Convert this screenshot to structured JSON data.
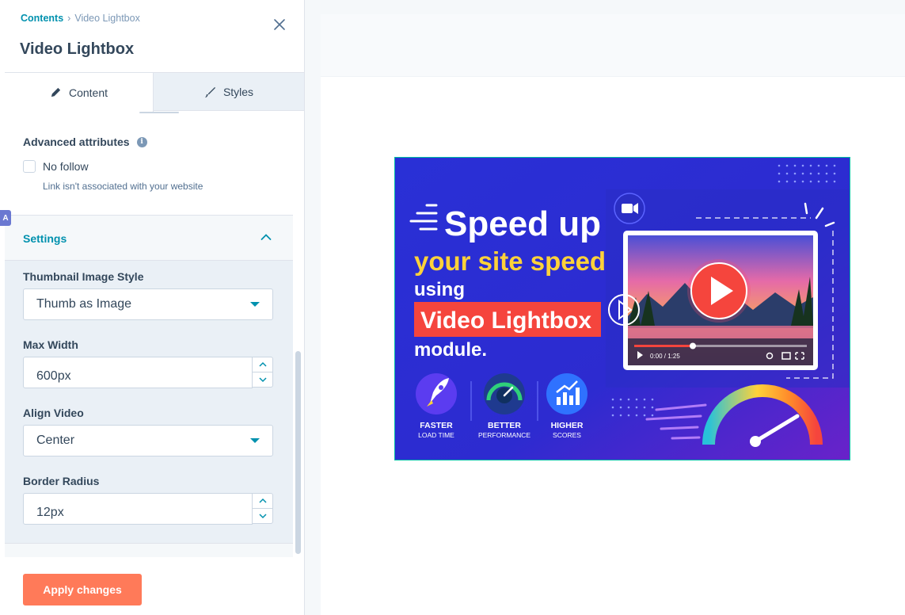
{
  "breadcrumb": {
    "parent": "Contents",
    "separator": "›",
    "current": "Video Lightbox"
  },
  "panel": {
    "title": "Video Lightbox"
  },
  "tabs": [
    {
      "label": "Content",
      "icon": "pencil-icon",
      "active": true
    },
    {
      "label": "Styles",
      "icon": "brush-icon",
      "active": false
    }
  ],
  "advanced": {
    "title": "Advanced attributes",
    "no_follow_label": "No follow",
    "no_follow_checked": false,
    "no_follow_help": "Link isn't associated with your website"
  },
  "badge": "A",
  "settings": {
    "title": "Settings",
    "thumbnail_style": {
      "label": "Thumbnail Image Style",
      "value": "Thumb as Image"
    },
    "max_width": {
      "label": "Max Width",
      "value": "600px"
    },
    "align_video": {
      "label": "Align Video",
      "value": "Center"
    },
    "border_radius": {
      "label": "Border Radius",
      "value": "12px"
    }
  },
  "footer": {
    "apply_label": "Apply changes"
  },
  "thumbnail": {
    "headline1": "Speed up",
    "headline2": "your site speed",
    "headline3": "using",
    "headline4": "Video Lightbox",
    "headline5": "module.",
    "player_time": "0:00 / 1:25",
    "features": [
      {
        "line1": "FASTER",
        "line2": "LOAD TIME"
      },
      {
        "line1": "BETTER",
        "line2": "PERFORMANCE"
      },
      {
        "line1": "HIGHER",
        "line2": "SCORES"
      }
    ]
  },
  "colors": {
    "accent": "#0091ae",
    "apply": "#ff7a59",
    "thumb_bg": "#2f2fd8",
    "thumb_yellow": "#ffd23a",
    "thumb_red": "#f5453d"
  }
}
